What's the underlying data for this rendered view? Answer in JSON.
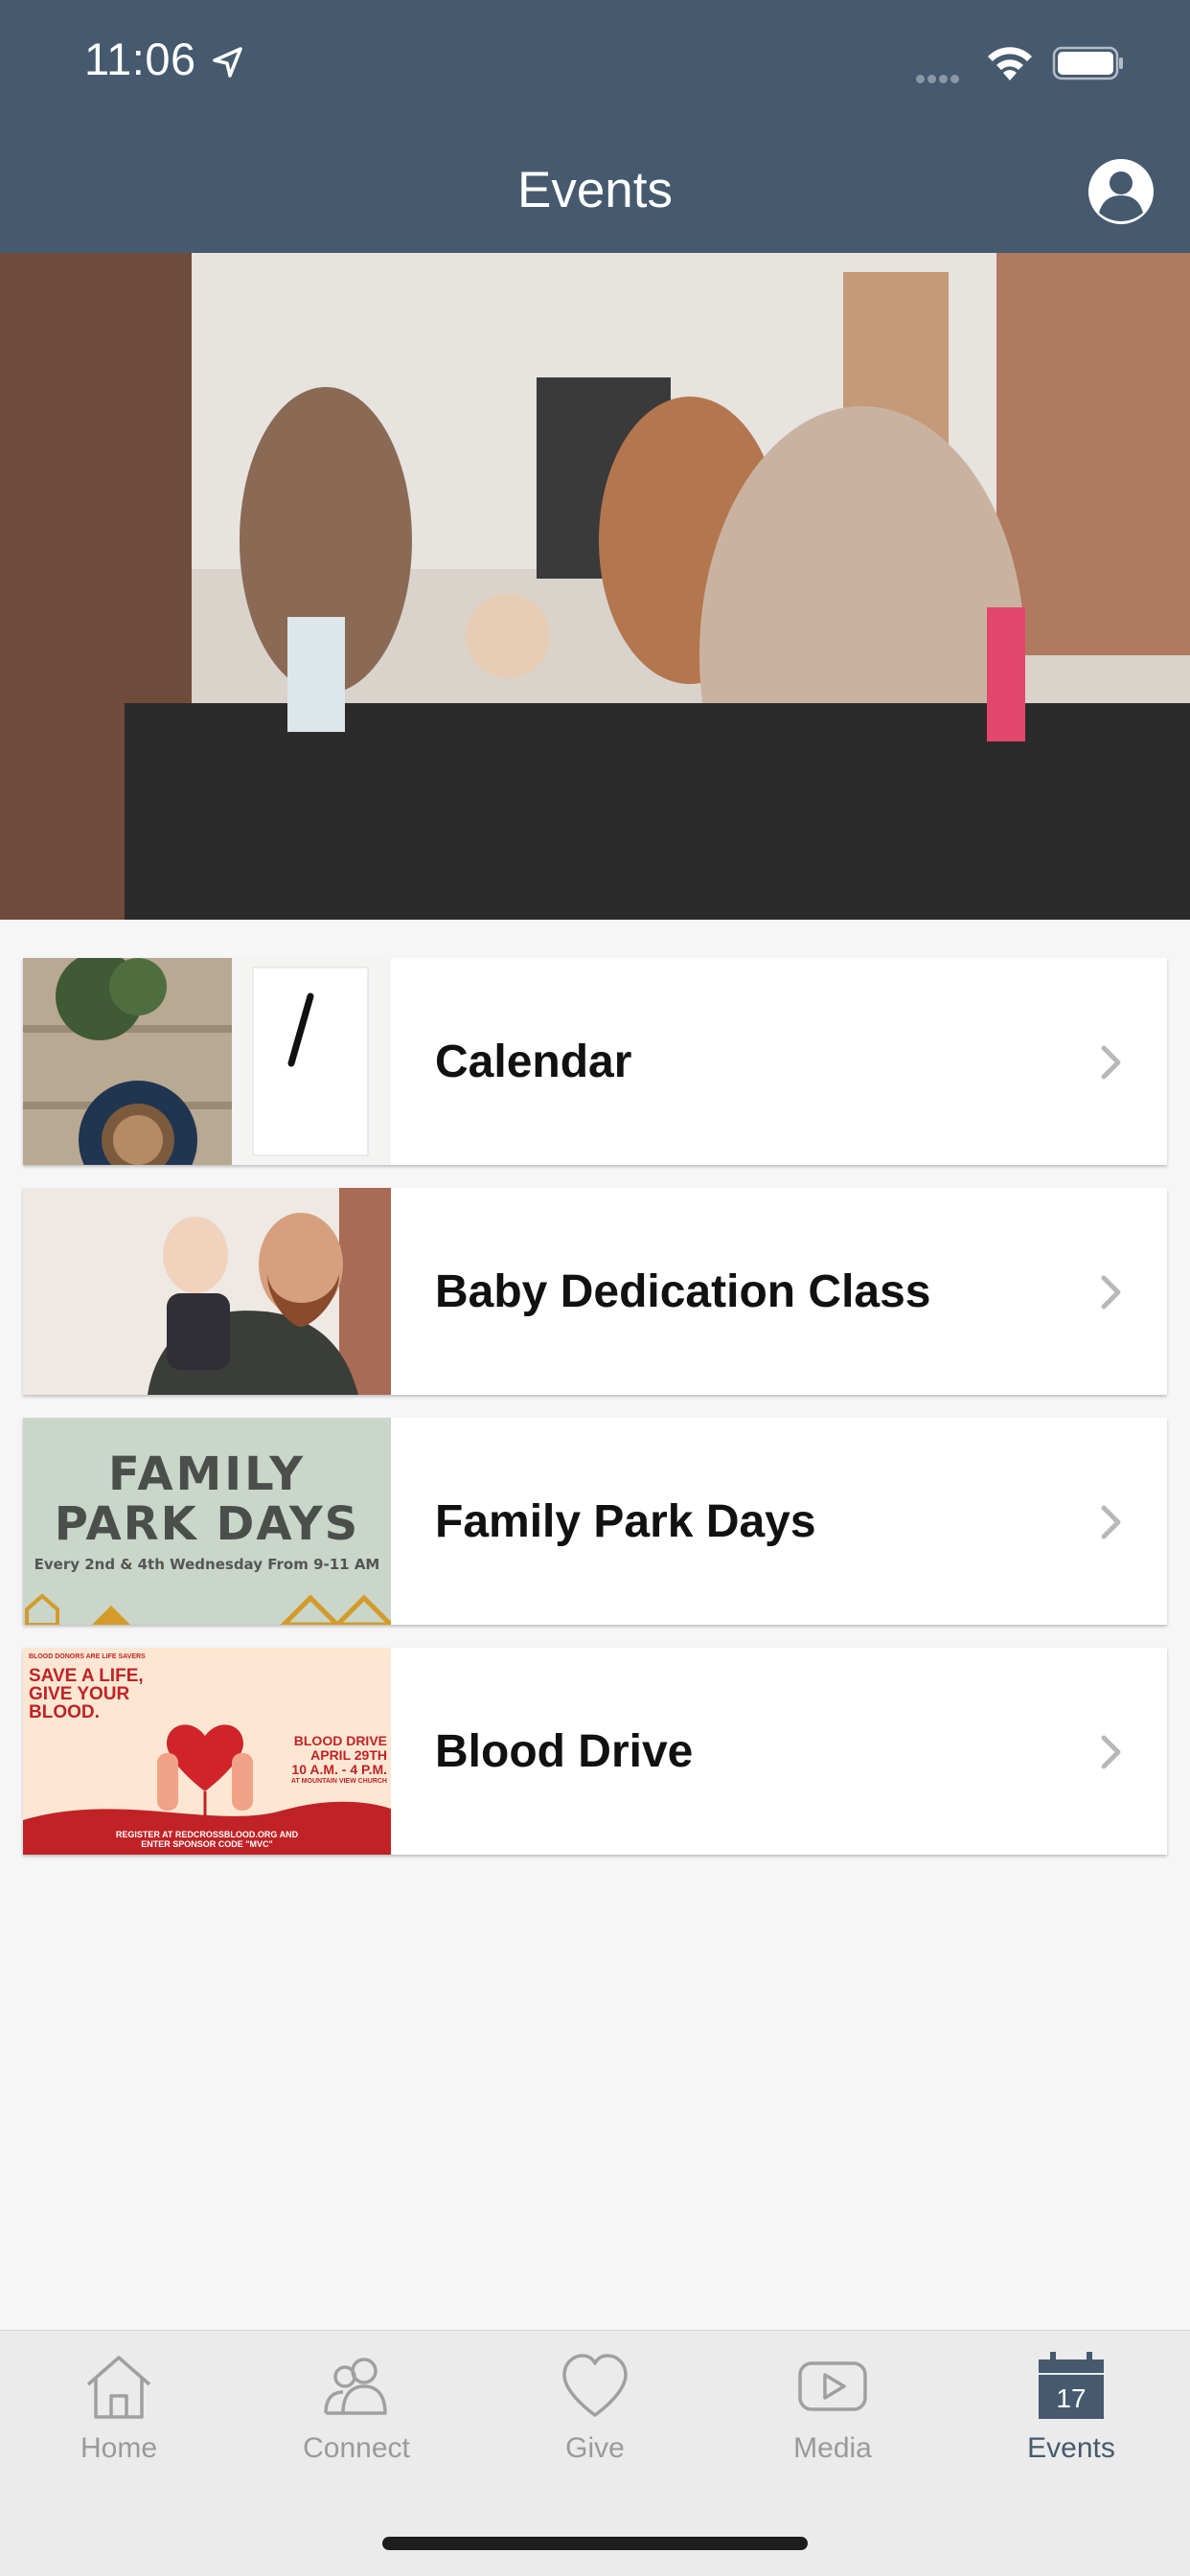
{
  "status_bar": {
    "time": "11:06"
  },
  "header": {
    "title": "Events"
  },
  "events": [
    {
      "label": "Calendar"
    },
    {
      "label": "Baby Dedication Class"
    },
    {
      "label": "Family Park Days",
      "thumb_title_1": "FAMILY",
      "thumb_title_2": "PARK DAYS",
      "thumb_sub": "Every 2nd & 4th Wednesday From 9-11 AM"
    },
    {
      "label": "Blood Drive",
      "thumb_top": "BLOOD DONORS ARE LIFE SAVERS",
      "thumb_head_1": "SAVE A LIFE,",
      "thumb_head_2": "GIVE YOUR",
      "thumb_head_3": "BLOOD.",
      "thumb_date_1": "BLOOD DRIVE",
      "thumb_date_2": "APRIL 29TH",
      "thumb_date_3": "10 A.M. - 4 P.M.",
      "thumb_date_4": "AT MOUNTAIN VIEW CHURCH",
      "thumb_foot_1": "REGISTER AT REDCROSSBLOOD.ORG AND",
      "thumb_foot_2": "ENTER SPONSOR CODE \"MVC\""
    }
  ],
  "tabs": [
    {
      "label": "Home",
      "icon": "home-icon"
    },
    {
      "label": "Connect",
      "icon": "people-icon"
    },
    {
      "label": "Give",
      "icon": "heart-icon"
    },
    {
      "label": "Media",
      "icon": "play-icon"
    },
    {
      "label": "Events",
      "icon": "calendar-icon",
      "badge": "17",
      "active": true
    }
  ],
  "colors": {
    "header": "#455a6e",
    "background": "#f6f6f6",
    "tab_active": "#455a6e",
    "tab_inactive": "#9a9a9a"
  }
}
